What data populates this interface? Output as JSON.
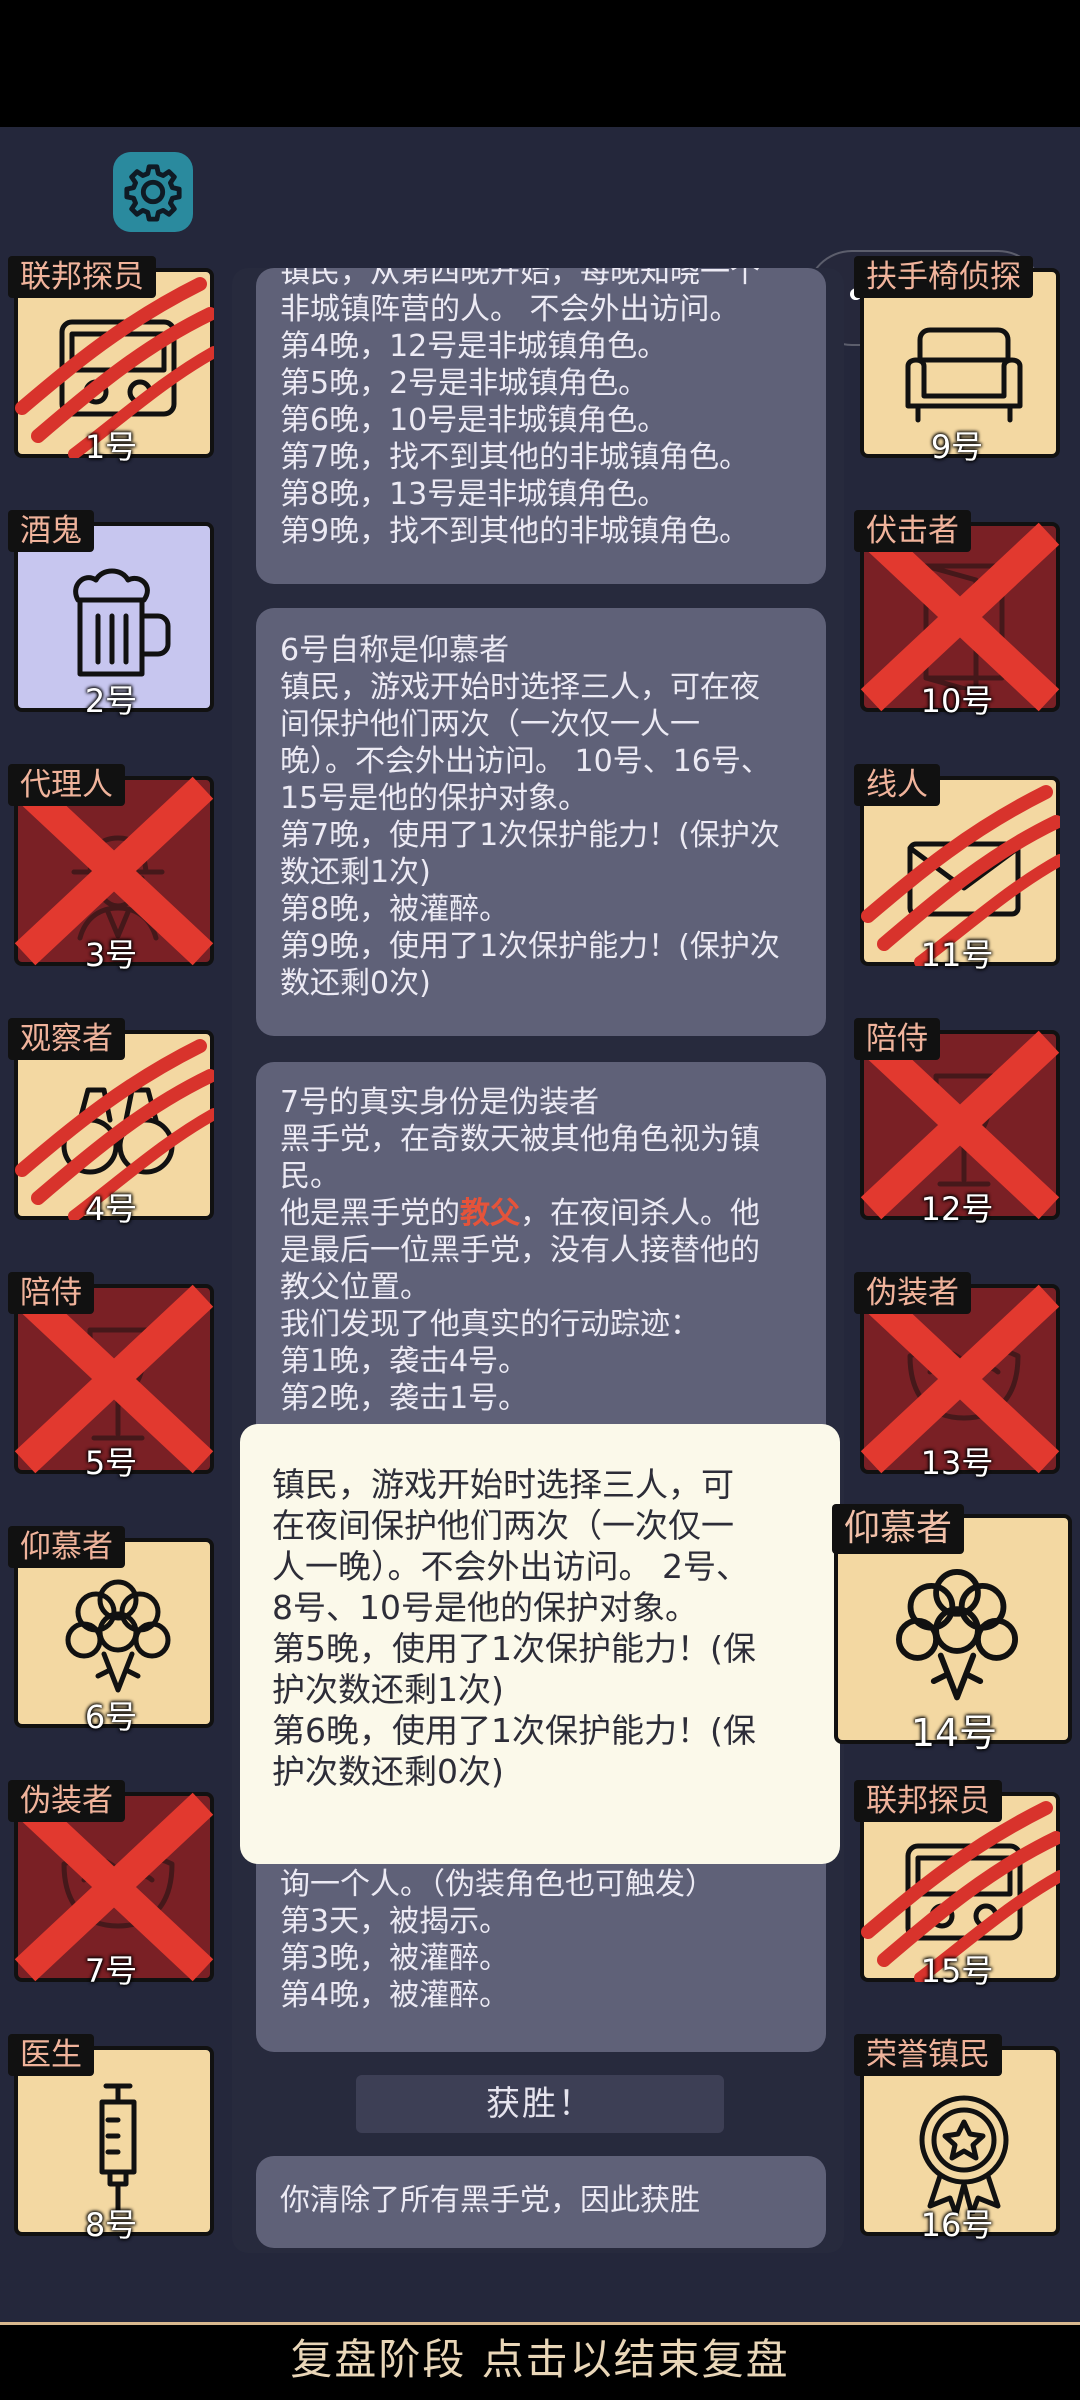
{
  "header": {
    "settings_icon": "gear-icon",
    "menu_icon": "more-dots-icon",
    "close_icon": "target-circle-icon"
  },
  "players_left": [
    {
      "role": "联邦探员",
      "number": "1号",
      "icon": "badge-id-icon",
      "state": "clawed"
    },
    {
      "role": "酒鬼",
      "number": "2号",
      "icon": "beer-mug-icon",
      "state": "drunk"
    },
    {
      "role": "代理人",
      "number": "3号",
      "icon": "agent-hat-icon",
      "state": "dead"
    },
    {
      "role": "观察者",
      "number": "4号",
      "icon": "binoculars-icon",
      "state": "clawed"
    },
    {
      "role": "陪侍",
      "number": "5号",
      "icon": "wine-glass-icon",
      "state": "dead"
    },
    {
      "role": "仰慕者",
      "number": "6号",
      "icon": "flower-bouquet-icon",
      "state": "alive"
    },
    {
      "role": "伪装者",
      "number": "7号",
      "icon": "mask-icon",
      "state": "dead"
    },
    {
      "role": "医生",
      "number": "8号",
      "icon": "syringe-icon",
      "state": "alive"
    }
  ],
  "players_right": [
    {
      "role": "扶手椅侦探",
      "number": "9号",
      "icon": "armchair-icon",
      "state": "alive"
    },
    {
      "role": "伏击者",
      "number": "10号",
      "icon": "door-icon",
      "state": "dead"
    },
    {
      "role": "线人",
      "number": "11号",
      "icon": "envelope-icon",
      "state": "clawed"
    },
    {
      "role": "陪侍",
      "number": "12号",
      "icon": "wine-glass-icon",
      "state": "dead"
    },
    {
      "role": "伪装者",
      "number": "13号",
      "icon": "mask-icon",
      "state": "dead"
    },
    {
      "role": "仰慕者",
      "number": "14号",
      "icon": "flower-bouquet-icon",
      "state": "alive-selected"
    },
    {
      "role": "联邦探员",
      "number": "15号",
      "icon": "badge-id-icon",
      "state": "clawed"
    },
    {
      "role": "荣誉镇民",
      "number": "16号",
      "icon": "medal-icon",
      "state": "alive"
    }
  ],
  "log": {
    "entry1": [
      "镇民，从第四晚开始，每晚知晓一个",
      "非城镇阵营的人。 不会外出访问。",
      "第4晚，12号是非城镇角色。",
      "第5晚，2号是非城镇角色。",
      "第6晚，10号是非城镇角色。",
      "第7晚，找不到其他的非城镇角色。",
      "第8晚，13号是非城镇角色。",
      "第9晚，找不到其他的非城镇角色。"
    ],
    "entry2": [
      "6号自称是仰慕者",
      "镇民，游戏开始时选择三人，可在夜",
      "间保护他们两次（一次仅一人一",
      "晚）。不会外出访问。 10号、16号、",
      "15号是他的保护对象。",
      "第7晚，使用了1次保护能力！(保护次",
      "数还剩1次)",
      "第8晚，被灌醉。",
      "第9晚，使用了1次保护能力！(保护次",
      "数还剩0次)"
    ],
    "entry3": {
      "l1": "7号的真实身份是伪装者",
      "l2": "黑手党，在奇数天被其他角色视为镇",
      "l3": "民。",
      "l4_pre": "他是黑手党的",
      "l4_red": "教父",
      "l4_post": "，在夜间杀人。他",
      "l5": "是最后一位黑手党，没有人接替他的",
      "l6": "教父位置。",
      "l7": "我们发现了他真实的行动踪迹：",
      "l8": "第1晚，袭击4号。",
      "l9": "第2晚，袭击1号。"
    },
    "entry4": [
      "询一个人。（伪装角色也可触发）",
      "第3天，被揭示。",
      "第3晚，被灌醉。",
      "第4晚，被灌醉。"
    ],
    "victory": "获胜！",
    "result": "你清除了所有黑手党，因此获胜"
  },
  "tooltip": [
    "镇民，游戏开始时选择三人，可",
    "在夜间保护他们两次（一次仅一",
    "人一晚）。不会外出访问。 2号、",
    "8号、10号是他的保护对象。",
    "第5晚，使用了1次保护能力！(保",
    "护次数还剩1次)",
    "第6晚，使用了1次保护能力！(保",
    "护次数还剩0次)"
  ],
  "footer": {
    "text": "复盘阶段 点击以结束复盘"
  },
  "colors": {
    "alive": "#f3d8a2",
    "dead": "#7a2025",
    "drunk": "#c7c6ef",
    "cross": "#e2392f",
    "highlight": "#e5533a"
  }
}
